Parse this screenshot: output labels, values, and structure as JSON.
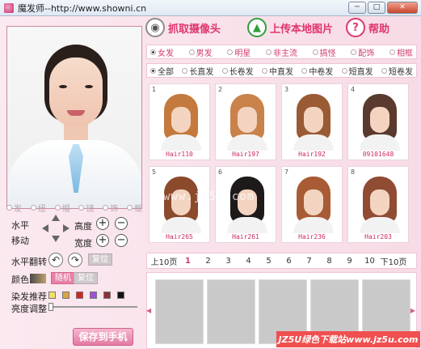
{
  "window": {
    "title": "魔发师--http://www.showni.cn",
    "buttons": {
      "minimize": "─",
      "maximize": "□",
      "close": "✕"
    }
  },
  "toolbar": {
    "capture_label": "抓取摄像头",
    "upload_label": "上传本地图片",
    "help_label": "帮助",
    "help_icon_text": "?"
  },
  "category_tabs": [
    {
      "label": "女发",
      "selected": true
    },
    {
      "label": "男发",
      "selected": false
    },
    {
      "label": "明星",
      "selected": false
    },
    {
      "label": "非主流",
      "selected": false
    },
    {
      "label": "搞怪",
      "selected": false
    },
    {
      "label": "配饰",
      "selected": false
    },
    {
      "label": "相框",
      "selected": false
    }
  ],
  "length_tabs": [
    {
      "label": "全部",
      "selected": true
    },
    {
      "label": "长直发",
      "selected": false
    },
    {
      "label": "长卷发",
      "selected": false
    },
    {
      "label": "中直发",
      "selected": false
    },
    {
      "label": "中卷发",
      "selected": false
    },
    {
      "label": "短直发",
      "selected": false
    },
    {
      "label": "短卷发",
      "selected": false
    }
  ],
  "left_radio_labels": [
    "发",
    "纽",
    "帽",
    "镜",
    "饰",
    "框"
  ],
  "controls": {
    "horizontal_label": "水平",
    "move_label": "移动",
    "height_label": "高度",
    "width_label": "宽度",
    "plus": "+",
    "minus": "−",
    "flip_label": "水平翻转",
    "reset_label": "复位",
    "color_label": "颜色",
    "random_label": "随机",
    "color_reset_label": "复位",
    "dye_label": "染发推荐",
    "brightness_label": "亮度调整",
    "save_label": "保存到手机"
  },
  "dye_colors": [
    "#f1df6a",
    "#d9a545",
    "#d7231f",
    "#9b52d9",
    "#8f2f38",
    "#121212"
  ],
  "hairstyles": [
    {
      "num": "1",
      "label": "Hair110",
      "hair_color": "#c47a3c"
    },
    {
      "num": "2",
      "label": "Hair197",
      "hair_color": "#c8824a"
    },
    {
      "num": "3",
      "label": "Hair192",
      "hair_color": "#9a5a34"
    },
    {
      "num": "4",
      "label": "09101648",
      "hair_color": "#5a3a2e"
    },
    {
      "num": "5",
      "label": "Hair265",
      "hair_color": "#8c4a2c"
    },
    {
      "num": "6",
      "label": "Hair261",
      "hair_color": "#1e1a1a"
    },
    {
      "num": "7",
      "label": "Hair236",
      "hair_color": "#a85b34"
    },
    {
      "num": "8",
      "label": "Hair203",
      "hair_color": "#8f4c33"
    }
  ],
  "watermark_text": "www.jz5u.com",
  "pager": {
    "prev_label": "上10页",
    "next_label": "下10页",
    "pages": [
      "1",
      "2",
      "3",
      "4",
      "5",
      "6",
      "7",
      "8",
      "9",
      "10"
    ],
    "current": "1"
  },
  "footer_watermark": "JZ5U绿色下载站www.jz5u.com"
}
